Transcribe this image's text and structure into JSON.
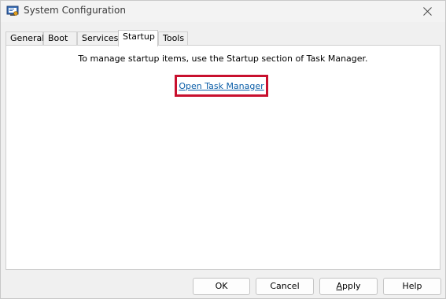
{
  "window": {
    "title": "System Configuration",
    "close_glyph": "✕"
  },
  "tabs": [
    {
      "label": "General",
      "active": false
    },
    {
      "label": "Boot",
      "active": false
    },
    {
      "label": "Services",
      "active": false
    },
    {
      "label": "Startup",
      "active": true
    },
    {
      "label": "Tools",
      "active": false
    }
  ],
  "startup": {
    "instructions": "To manage startup items, use the Startup section of Task Manager.",
    "link_label": "Open Task Manager",
    "highlight_color": "#c8102e",
    "link_color": "#0b5ea8"
  },
  "buttons": {
    "ok": "OK",
    "cancel": "Cancel",
    "apply_first": "A",
    "apply_rest": "pply",
    "help": "Help"
  },
  "icons": {
    "app": "msconfig-icon",
    "close": "close-icon"
  }
}
